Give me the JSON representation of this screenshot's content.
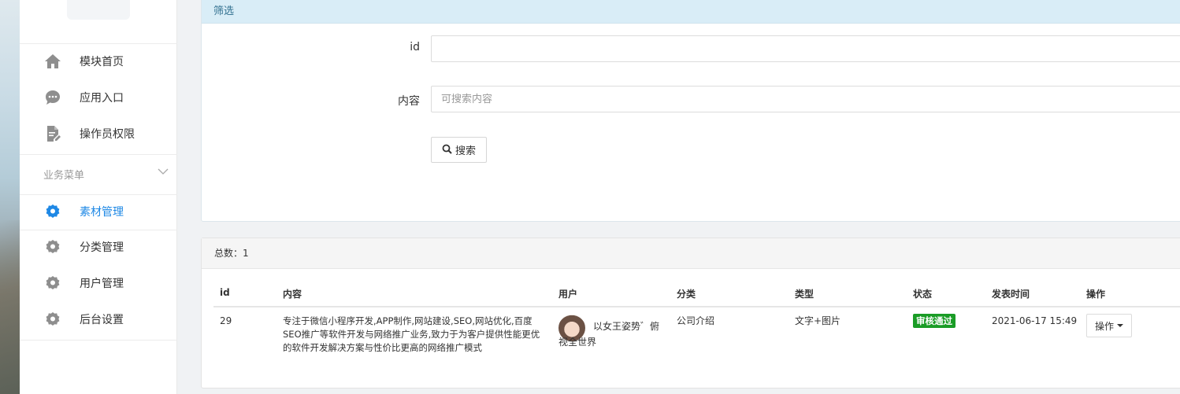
{
  "sidebar": {
    "items": [
      {
        "label": "模块首页",
        "icon": "home-icon"
      },
      {
        "label": "应用入口",
        "icon": "chat-icon"
      },
      {
        "label": "操作员权限",
        "icon": "document-edit-icon"
      }
    ],
    "group": {
      "title": "业务菜单",
      "items": [
        {
          "label": "素材管理",
          "icon": "gear-icon",
          "active": true
        },
        {
          "label": "分类管理",
          "icon": "gear-icon"
        },
        {
          "label": "用户管理",
          "icon": "gear-icon"
        },
        {
          "label": "后台设置",
          "icon": "gear-icon"
        }
      ]
    }
  },
  "filter": {
    "header": "筛选",
    "id_label": "id",
    "id_value": "",
    "content_label": "内容",
    "content_placeholder": "可搜索内容",
    "search_label": "搜索"
  },
  "list": {
    "total_text": "总数：1",
    "columns": [
      "id",
      "内容",
      "用户",
      "分类",
      "类型",
      "状态",
      "发表时间",
      "操作"
    ],
    "rows": [
      {
        "id": "29",
        "content": "专注于微信小程序开发,APP制作,网站建设,SEO,网站优化,百度SEO推广等软件开发与网络推广业务,致力于为客户提供性能更优的软件开发解决方案与性价比更高的网络推广模式",
        "user": "以女王姿势゛俯视全世界",
        "category": "公司介绍",
        "type": "文字+图片",
        "status": "审核通过",
        "time": "2021-06-17 15:49",
        "op_label": "操作"
      }
    ]
  },
  "colors": {
    "accent": "#1e88e5",
    "panel_header_blue": "#d9edf7",
    "status_green": "#1a9c26"
  }
}
